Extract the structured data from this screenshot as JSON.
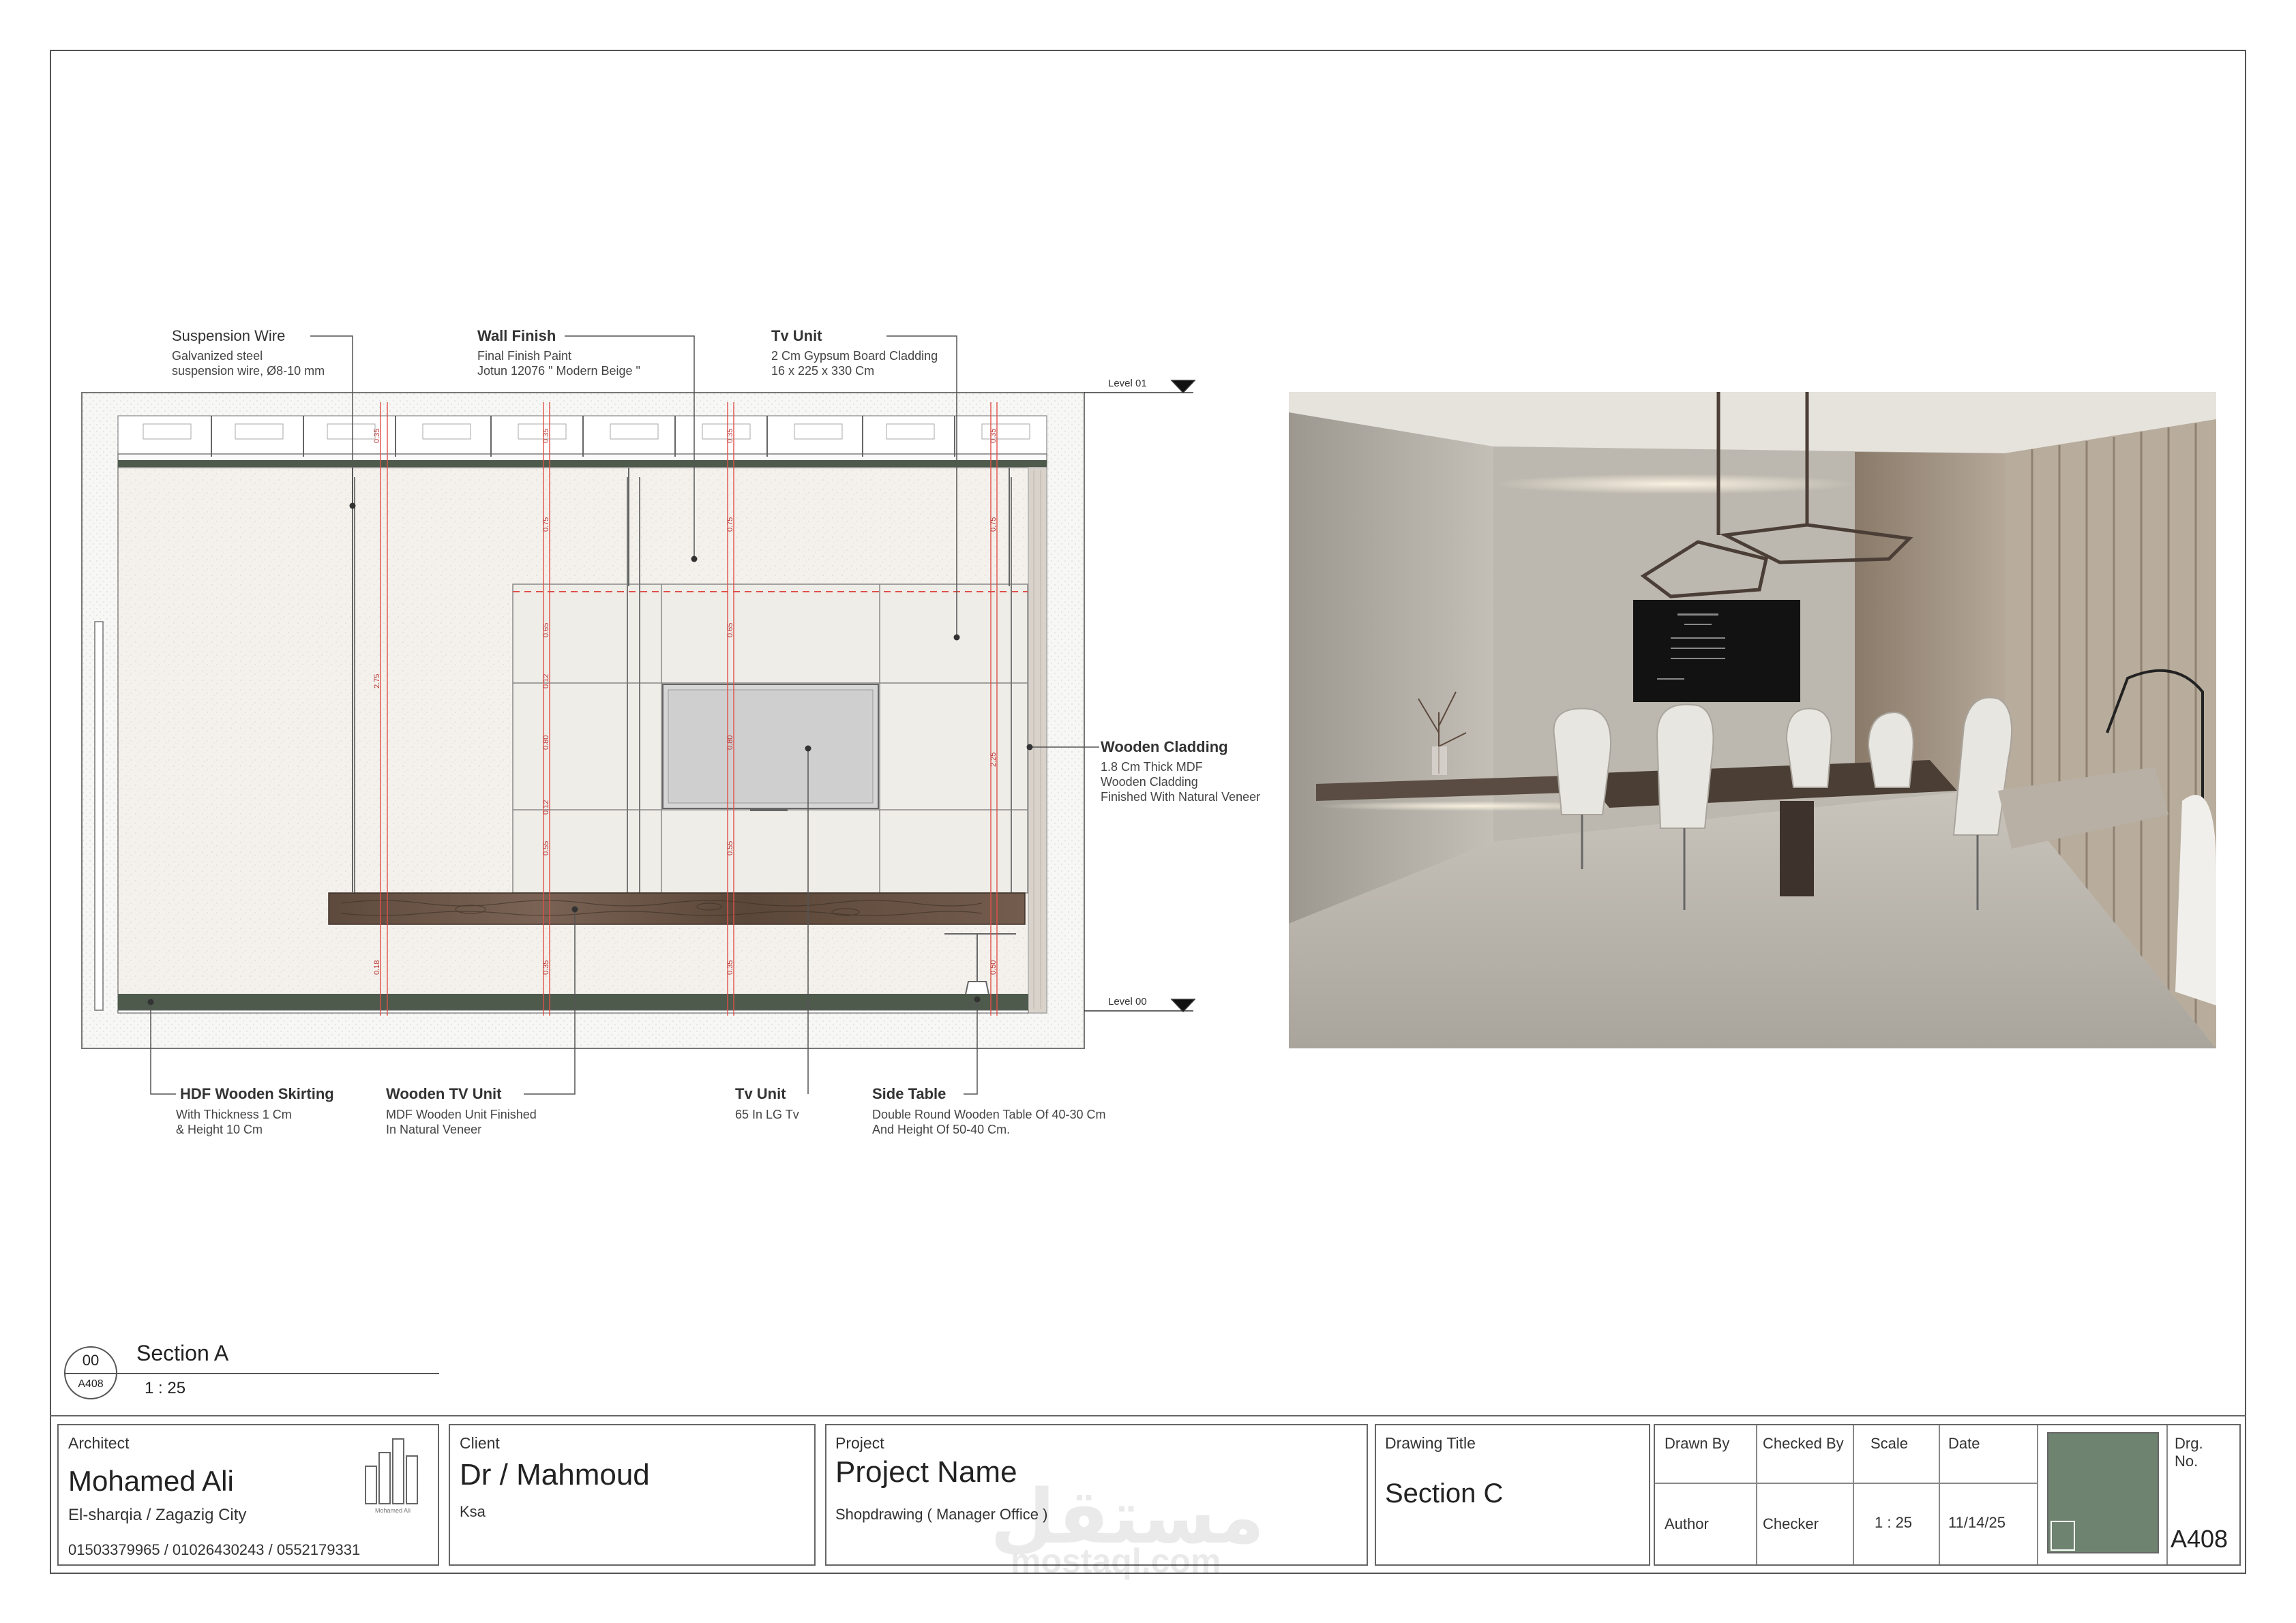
{
  "callouts": {
    "suspension_wire": {
      "title": "Suspension Wire",
      "desc": "Galvanized steel\nsuspension wire, Ø8-10 mm"
    },
    "wall_finish": {
      "title": "Wall Finish",
      "desc": "Final Finish Paint\nJotun 12076 \" Modern Beige \""
    },
    "tv_unit_top": {
      "title": "Tv Unit",
      "desc": "2 Cm Gypsum Board Cladding\n16 x 225 x 330 Cm"
    },
    "wooden_cladding": {
      "title": "Wooden Cladding",
      "desc": "1.8 Cm Thick MDF\nWooden Cladding\nFinished With Natural Veneer"
    },
    "hdf_skirting": {
      "title": "HDF Wooden Skirting",
      "desc": "With Thickness 1 Cm\n& Height 10 Cm"
    },
    "wooden_tv_unit": {
      "title": "Wooden TV Unit",
      "desc": "MDF Wooden Unit Finished\nIn Natural Veneer"
    },
    "tv_unit_bottom": {
      "title": "Tv Unit",
      "desc": "65 In LG Tv"
    },
    "side_table": {
      "title": "Side Table",
      "desc": "Double Round Wooden Table Of 40-30 Cm\nAnd Height Of 50-40 Cm."
    }
  },
  "levels": {
    "top": "Level 01",
    "bottom": "Level 00"
  },
  "dimensions": {
    "top_row": [
      "0.35",
      "0.35",
      "0.35",
      "0.35"
    ],
    "second_row": [
      "0.75",
      "0.75",
      "0.75"
    ],
    "left_total": "2.75",
    "right_total": "2.25",
    "tv_col_a": [
      "0.65",
      "0.12",
      "0.80",
      "0.12",
      "0.55"
    ],
    "tv_col_b": [
      "0.65",
      "0.80",
      "0.55"
    ],
    "bottom_row": [
      "0.18",
      "0.35",
      "0.35",
      "0.50"
    ]
  },
  "section_tag": {
    "number": "00",
    "sheet": "A408",
    "name": "Section A",
    "scale": "1 : 25"
  },
  "title_block": {
    "architect": {
      "caption": "Architect",
      "name": "Mohamed Ali",
      "city": "El-sharqia / Zagazig City",
      "phones": "01503379965 / 01026430243 / 0552179331",
      "logo_text": "Mohamed Ali"
    },
    "client": {
      "caption": "Client",
      "name": "Dr / Mahmoud",
      "location": "Ksa"
    },
    "project": {
      "caption": "Project",
      "name": "Project Name",
      "desc": "Shopdrawing ( Manager Office )"
    },
    "drawing_title": {
      "caption": "Drawing Title",
      "value": "Section C"
    },
    "drawn_by": {
      "caption": "Drawn By",
      "value": "Author"
    },
    "checked_by": {
      "caption": "Checked By",
      "value": "Checker"
    },
    "scale": {
      "caption": "Scale",
      "value": "1 : 25"
    },
    "date": {
      "caption": "Date",
      "value": "11/14/25"
    },
    "drg": {
      "caption": "Drg.\nNo.",
      "value": "A408"
    }
  },
  "watermark": {
    "arabic": "مستقل",
    "latin": "mostaql.com"
  },
  "colors": {
    "skirting": "#4d5a4c",
    "wood": "#6b5446",
    "dim_red": "#e0504a",
    "key_plan": "#6f8470"
  }
}
